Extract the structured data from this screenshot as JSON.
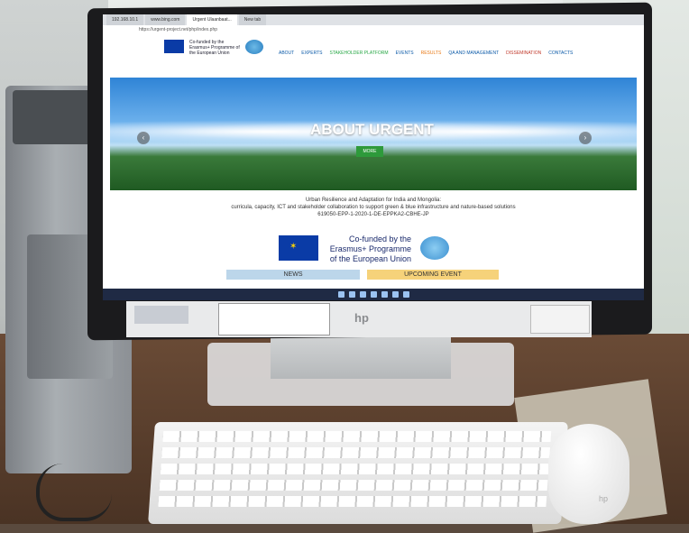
{
  "browser": {
    "tabs": [
      "192.168.10.1",
      "www.bing.com",
      "Urgent Ulaanbaat...",
      "New tab"
    ],
    "url": "https://urgent-project.net/php/index.php"
  },
  "site": {
    "eu_text": "Co-funded by the Erasmus+ Programme of the European Union",
    "nav": [
      "ABOUT",
      "EXPERTS",
      "STAKEHOLDER PLATFORM",
      "EVENTS",
      "RESULTS",
      "QA AND MANAGEMENT",
      "DISSEMINATION",
      "CONTACTS"
    ],
    "nav_colors": [
      "#0b5aa8",
      "#0b5aa8",
      "#27a745",
      "#0b5aa8",
      "#e87a17",
      "#0b5aa8",
      "#c0392b",
      "#0b5aa8"
    ],
    "hero_title": "ABOUT URGENT",
    "hero_button": "MORE",
    "arrow_prev": "‹",
    "arrow_next": "›",
    "project_title": "Urban Resilience and Adaptation for India and Mongolia:",
    "project_desc": "curricula, capacity, ICT and stakeholder collaboration to support green & blue infrastructure and nature-based solutions",
    "project_code": "619050-EPP-1-2020-1-DE-EPPKA2-CBHE-JP",
    "eu_big_text": "Co-funded by the Erasmus+ Programme of the European Union",
    "news_label": "NEWS",
    "event_label": "UPCOMING EVENT"
  },
  "monitor": {
    "brand": "hp"
  },
  "mouse": {
    "brand": "hp"
  }
}
